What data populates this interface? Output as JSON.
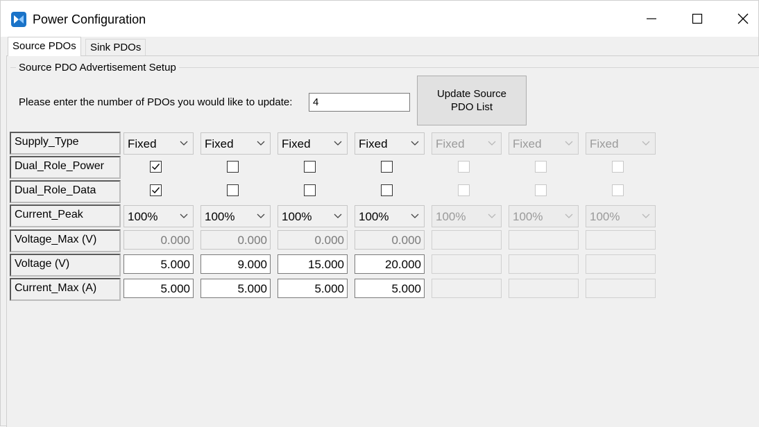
{
  "window": {
    "title": "Power Configuration",
    "icon": "app-logo-icon",
    "controls": [
      "minimize-icon",
      "maximize-icon",
      "close-icon"
    ]
  },
  "tabs": [
    {
      "label": "Source PDOs",
      "active": true
    },
    {
      "label": "Sink PDOs",
      "active": false
    }
  ],
  "group": {
    "title": "Source PDO Advertisement Setup"
  },
  "prompt": {
    "label": "Please enter the number of PDOs you would like to update:",
    "value": "4"
  },
  "update_button": {
    "line1": "Update Source",
    "line2": "PDO List"
  },
  "row_labels": {
    "supply_type": "Supply_Type",
    "dual_role_power": "Dual_Role_Power",
    "dual_role_data": "Dual_Role_Data",
    "current_peak": "Current_Peak",
    "voltage_max": "Voltage_Max (V)",
    "voltage": "Voltage (V)",
    "current_max": "Current_Max (A)"
  },
  "pdos": [
    {
      "enabled": true,
      "supply_type": "Fixed",
      "dual_role_power": true,
      "dual_role_data": true,
      "current_peak": "100%",
      "voltage_max": "0.000",
      "voltage": "5.000",
      "current_max": "5.000"
    },
    {
      "enabled": true,
      "supply_type": "Fixed",
      "dual_role_power": false,
      "dual_role_data": false,
      "current_peak": "100%",
      "voltage_max": "0.000",
      "voltage": "9.000",
      "current_max": "5.000"
    },
    {
      "enabled": true,
      "supply_type": "Fixed",
      "dual_role_power": false,
      "dual_role_data": false,
      "current_peak": "100%",
      "voltage_max": "0.000",
      "voltage": "15.000",
      "current_max": "5.000"
    },
    {
      "enabled": true,
      "supply_type": "Fixed",
      "dual_role_power": false,
      "dual_role_data": false,
      "current_peak": "100%",
      "voltage_max": "0.000",
      "voltage": "20.000",
      "current_max": "5.000"
    },
    {
      "enabled": false,
      "supply_type": "Fixed",
      "dual_role_power": false,
      "dual_role_data": false,
      "current_peak": "100%",
      "voltage_max": "",
      "voltage": "",
      "current_max": ""
    },
    {
      "enabled": false,
      "supply_type": "Fixed",
      "dual_role_power": false,
      "dual_role_data": false,
      "current_peak": "100%",
      "voltage_max": "",
      "voltage": "",
      "current_max": ""
    },
    {
      "enabled": false,
      "supply_type": "Fixed",
      "dual_role_power": false,
      "dual_role_data": false,
      "current_peak": "100%",
      "voltage_max": "",
      "voltage": "",
      "current_max": ""
    }
  ]
}
